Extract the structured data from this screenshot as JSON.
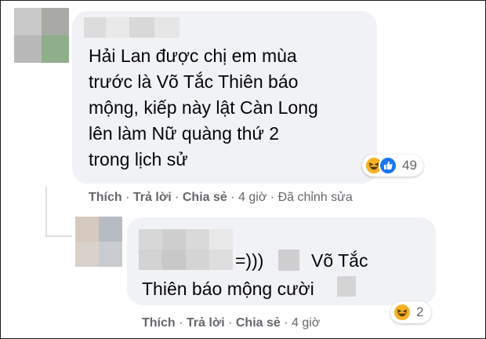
{
  "comment": {
    "lines": [
      "Hải Lan được chị em mùa",
      "trước là Võ Tắc Thiên báo",
      "mộng, kiếp này lật Càn Long",
      "lên làm Nữ quàng thứ 2",
      "trong lịch sử"
    ],
    "reaction_count": "49",
    "reaction_icons": [
      "haha-icon",
      "like-icon"
    ],
    "actions": {
      "like": "Thích",
      "reply": "Trả lời",
      "share": "Chia sẻ",
      "time": "4 giờ",
      "edited": "Đã chỉnh sửa"
    }
  },
  "reply": {
    "line1_a": "=)))",
    "line1_b": "Võ Tắc",
    "line2": "Thiên báo mộng cười",
    "reaction_count": "2",
    "reaction_icons": [
      "haha-icon"
    ],
    "actions": {
      "like": "Thích",
      "reply": "Trả lời",
      "share": "Chia sẻ",
      "time": "4 giờ"
    }
  },
  "colors": {
    "bubble": "#f0f2f5",
    "text": "#050505",
    "meta": "#65676b",
    "like_blue": "#1877f2",
    "haha_yellow": "#f7b125"
  }
}
